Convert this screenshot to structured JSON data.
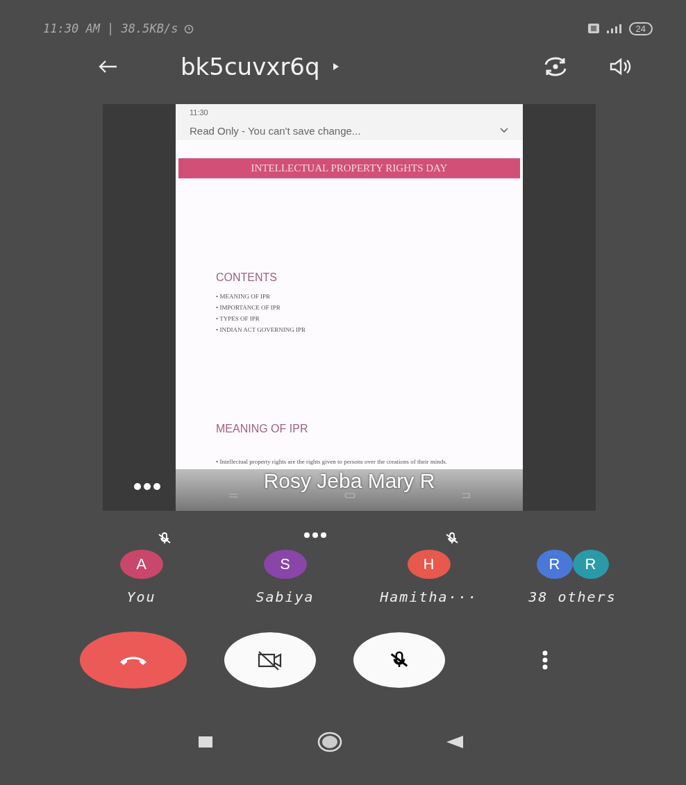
{
  "status_bar": {
    "time": "11:30 AM | 38.5KB/s",
    "battery": "24"
  },
  "header": {
    "title": "bk5cuvxr6q"
  },
  "shared_screen": {
    "presenter": "Rosy Jeba Mary R",
    "status_bar": {
      "time": "11:30"
    },
    "banner": "Read Only - You can't save change...",
    "slide_title": "INTELLECTUAL PROPERTY RIGHTS DAY",
    "contents_heading": "CONTENTS",
    "contents": [
      "• MEANING OF IPR",
      "• IMPORTANCE OF IPR",
      "• TYPES OF IPR",
      "• INDIAN ACT GOVERNING IPR"
    ],
    "section_heading": "MEANING OF IPR",
    "bullets": [
      "• Intellectual property rights are the rights given to persons over the creations of their minds."
    ]
  },
  "participants": [
    {
      "kind": "person",
      "initial": "A",
      "name": "You",
      "color": "#c9476a",
      "muted": true,
      "talking": false
    },
    {
      "kind": "person",
      "initial": "S",
      "name": "Sabiya",
      "color": "#8a45a8",
      "muted": false,
      "talking": true
    },
    {
      "kind": "person",
      "initial": "H",
      "name": "Hamitha···",
      "color": "#e8584c",
      "muted": true,
      "talking": false
    },
    {
      "kind": "group",
      "avatars": [
        {
          "initial": "R",
          "color": "#4a78d8"
        },
        {
          "initial": "R",
          "color": "#2a9aa8"
        }
      ],
      "name": "38 others"
    }
  ],
  "controls": {
    "camera_on": false,
    "mic_on": false
  }
}
